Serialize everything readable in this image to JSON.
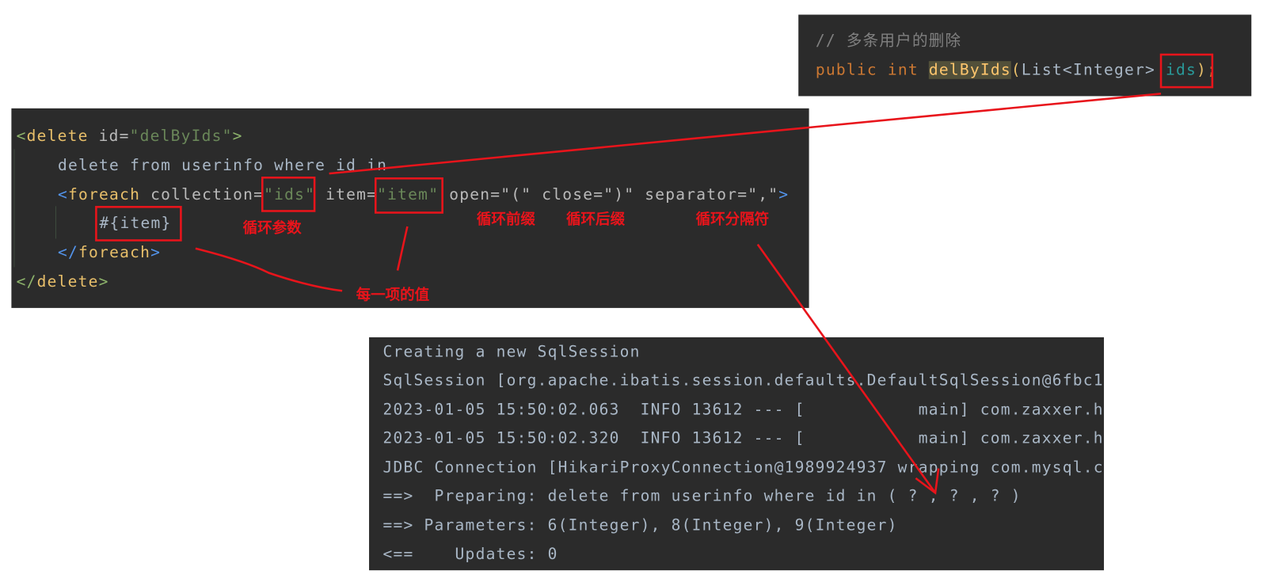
{
  "method_panel": {
    "comment": "// 多条用户的删除",
    "kw_public": "public",
    "kw_int": "int",
    "method_name": "delByIds",
    "open_paren": "(",
    "param_type": "List<Integer>",
    "param_name": "ids",
    "close_paren": ")",
    "semicolon": ";"
  },
  "xml_panel": {
    "l1": {
      "open": "<",
      "tag": "delete",
      "attr": " id=",
      "val": "\"delByIds\"",
      "close": ">"
    },
    "l2": "delete from userinfo where id in",
    "l3": {
      "open": "<",
      "tag": "foreach",
      "a1": " collection=",
      "v1": "\"ids\"",
      "a2": " item=",
      "v2": "\"item\"",
      "a3": " open=\"(\" close=\")\" separator=\",\"",
      "close": ">"
    },
    "l4": "#{item}",
    "l5": {
      "open": "</",
      "tag": "foreach",
      "close": ">"
    },
    "l6": {
      "open": "</",
      "tag": "delete",
      "close": ">"
    }
  },
  "annotations": {
    "collection": "循环参数",
    "open": "循环前缀",
    "close": "循环后缀",
    "separator": "循环分隔符",
    "item": "每一项的值",
    "color": "#e8141b"
  },
  "console": {
    "lines": [
      "Creating a new SqlSession",
      "SqlSession [org.apache.ibatis.session.defaults.DefaultSqlSession@6fbc1",
      "2023-01-05 15:50:02.063  INFO 13612 --- [           main] com.zaxxer.h",
      "2023-01-05 15:50:02.320  INFO 13612 --- [           main] com.zaxxer.h",
      "JDBC Connection [HikariProxyConnection@1989924937 wrapping com.mysql.c",
      "==>  Preparing: delete from userinfo where id in ( ? , ? , ? )",
      "==> Parameters: 6(Integer), 8(Integer), 9(Integer)",
      "<==    Updates: 0"
    ]
  }
}
